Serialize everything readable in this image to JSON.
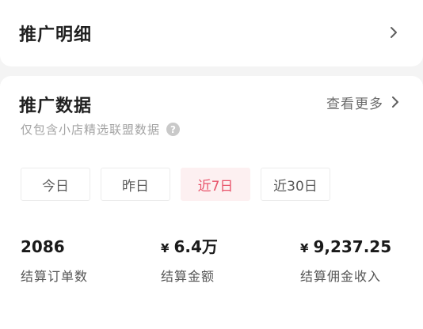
{
  "detail_section": {
    "title": "推广明细"
  },
  "data_section": {
    "title": "推广数据",
    "more_label": "查看更多",
    "subtitle": "仅包含小店精选联盟数据",
    "help_glyph": "?"
  },
  "tabs": [
    {
      "label": "今日",
      "active": false
    },
    {
      "label": "昨日",
      "active": false
    },
    {
      "label": "近7日",
      "active": true
    },
    {
      "label": "近30日",
      "active": false
    }
  ],
  "metrics": [
    {
      "currency": "",
      "value": "2086",
      "label": "结算订单数"
    },
    {
      "currency": "¥",
      "value": "6.4万",
      "label": "结算金额"
    },
    {
      "currency": "¥",
      "value": "9,237.25",
      "label": "结算佣金收入"
    }
  ],
  "colors": {
    "accent": "#e8536a",
    "accent_bg": "#fdf0f1",
    "page_bg": "#f4f4f4"
  },
  "icons": {
    "detail_arrow": "chevron-right-icon",
    "more_arrow": "chevron-right-icon",
    "help": "question-circle-icon"
  }
}
